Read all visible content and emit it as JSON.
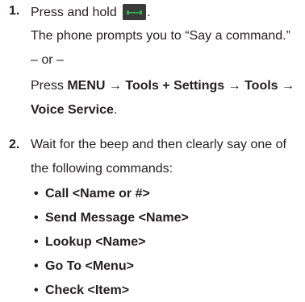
{
  "steps": [
    {
      "number": "1.",
      "line1_text": "Press and hold",
      "line1_after": ".",
      "key_icon": "talk-send-key-icon",
      "line2": "The phone prompts you to “Say a command.”",
      "or_text": "– or –",
      "alt_prefix": "Press ",
      "menu_label": "MENU",
      "arrow": "→",
      "tools_settings": "Tools + Settings",
      "tools": "Tools",
      "voice_service": "Voice Service",
      "period": "."
    },
    {
      "number": "2.",
      "line1": "Wait for the beep and then clearly say one of",
      "line2": "the following commands:",
      "commands": [
        "Call <Name or #>",
        "Send Message <Name>",
        "Lookup <Name>",
        "Go To <Menu>",
        "Check <Item>"
      ]
    }
  ],
  "colors": {
    "text": "#231f20",
    "key_green": "#2fb34a",
    "key_bg": "#3a3a3a"
  }
}
